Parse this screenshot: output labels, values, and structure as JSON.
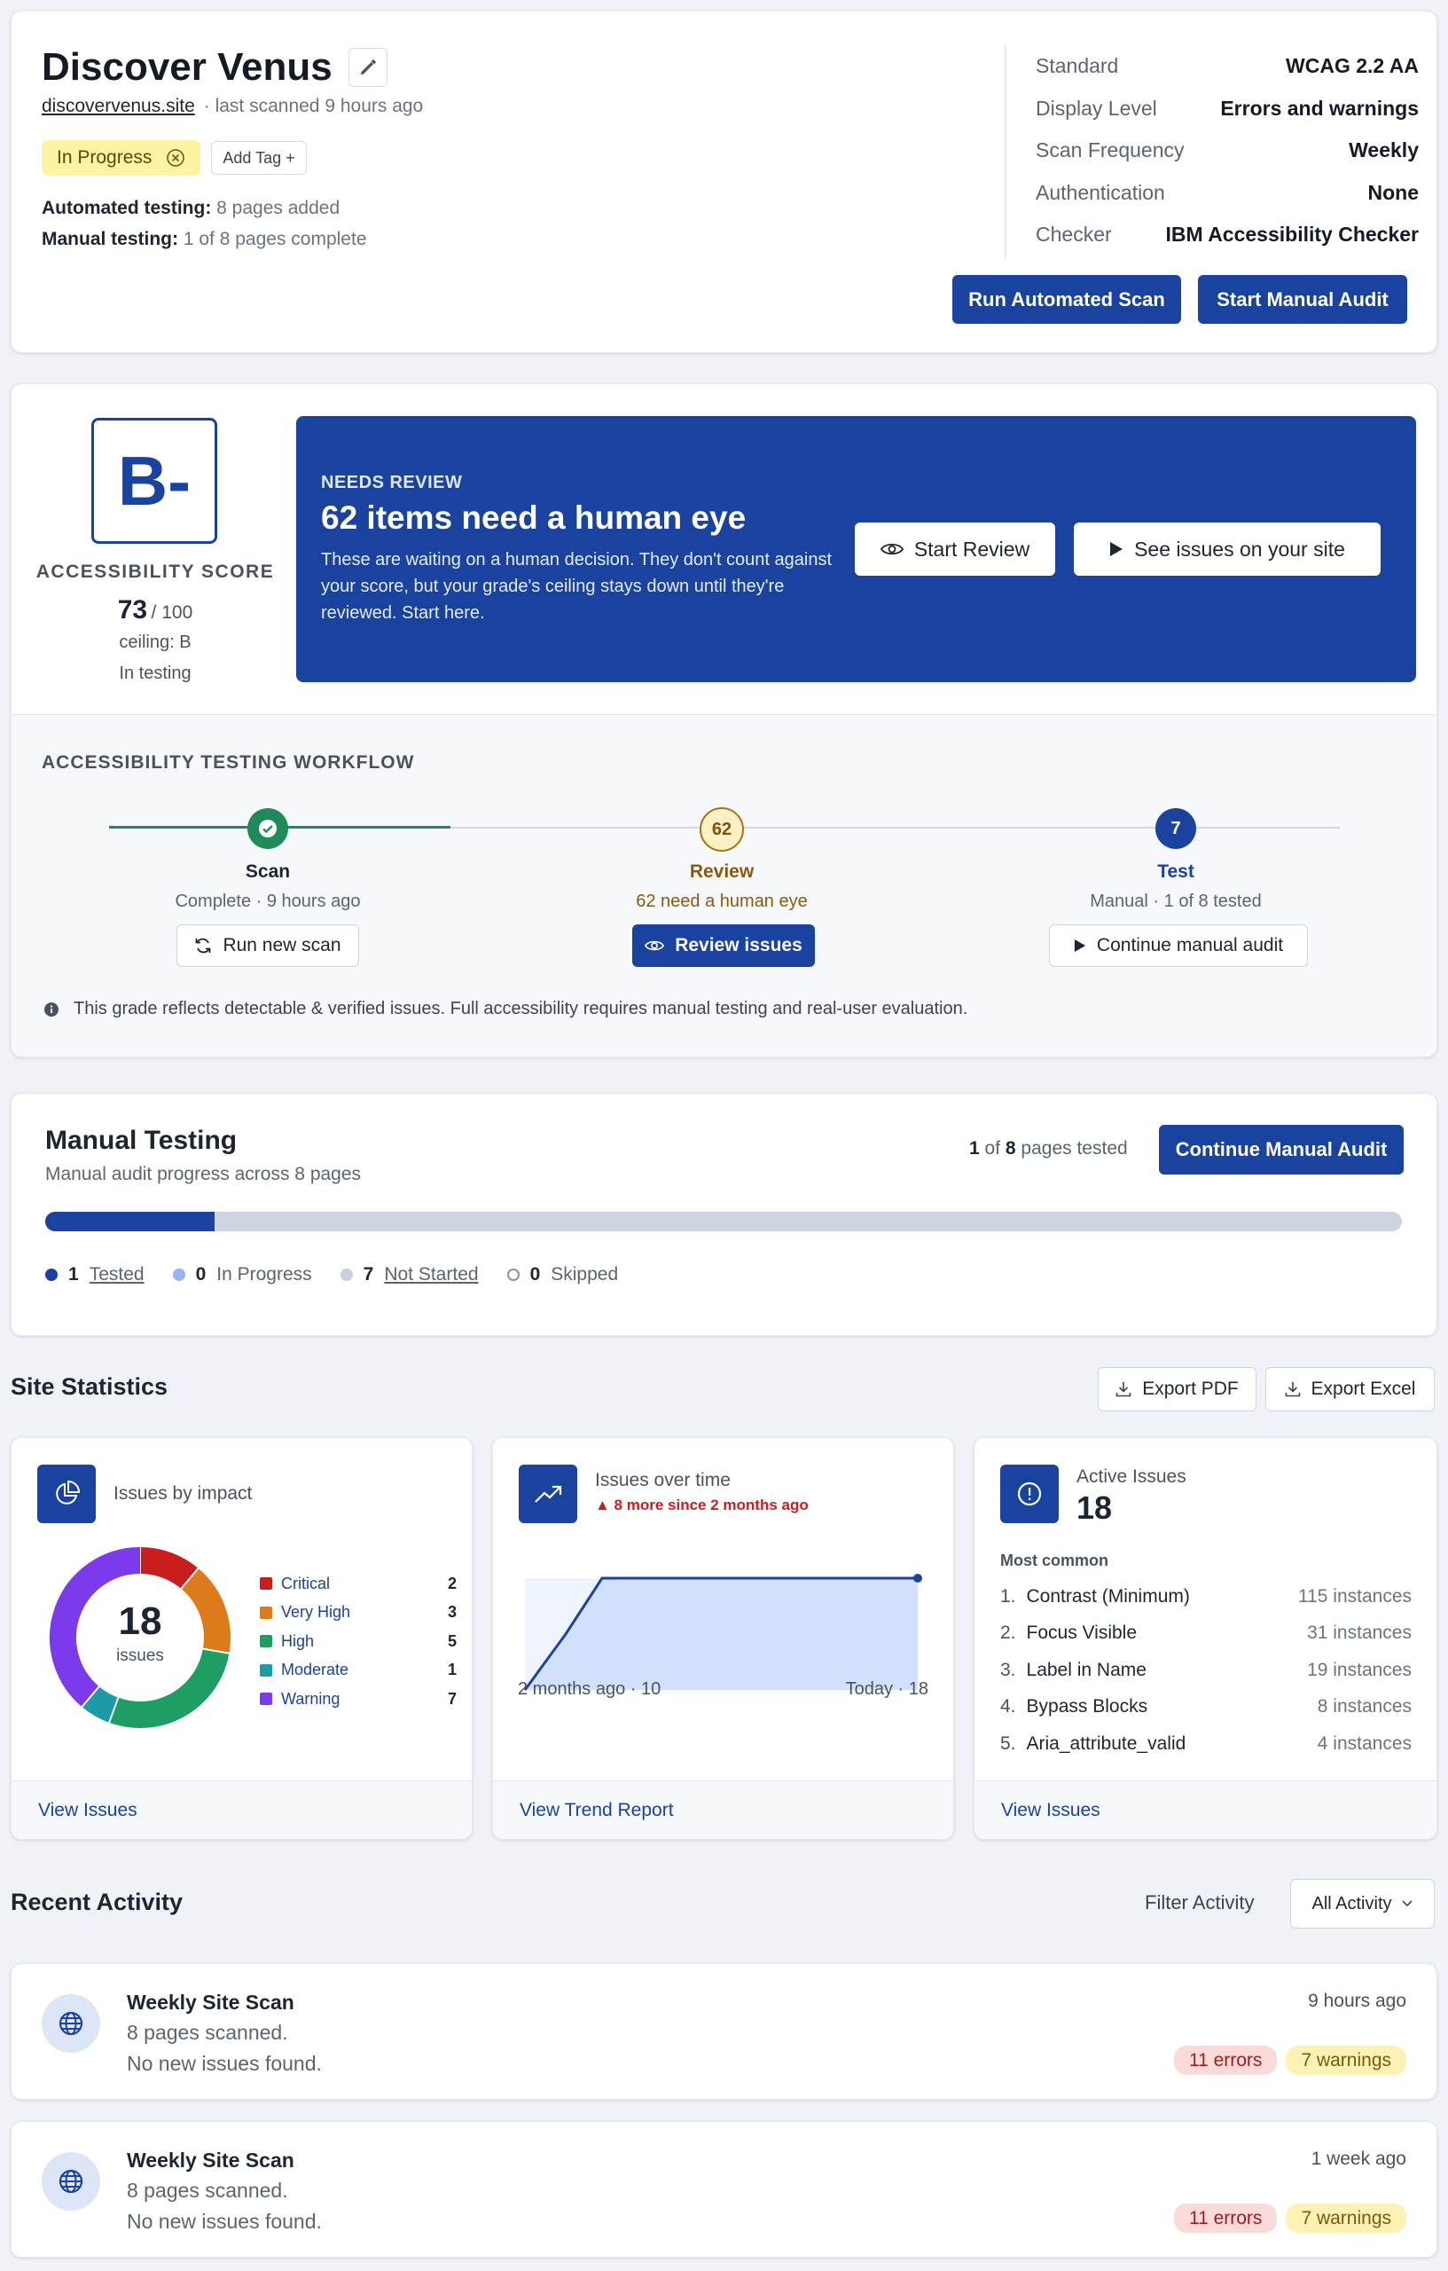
{
  "header": {
    "title": "Discover Venus",
    "site_link": "discovervenus.site",
    "scan_info": "· last scanned 9 hours ago",
    "status_tag": "In Progress",
    "add_tag": "Add Tag +",
    "automated_label": "Automated testing:",
    "automated_value": "8 pages added",
    "manual_label": "Manual testing:",
    "manual_value": "1 of 8 pages complete",
    "settings": [
      {
        "label": "Standard",
        "value": "WCAG 2.2 AA"
      },
      {
        "label": "Display Level",
        "value": "Errors and warnings"
      },
      {
        "label": "Scan Frequency",
        "value": "Weekly"
      },
      {
        "label": "Authentication",
        "value": "None"
      },
      {
        "label": "Checker",
        "value": "IBM Accessibility Checker"
      }
    ],
    "run_scan_button": "Run Automated Scan",
    "start_audit_button": "Start Manual Audit"
  },
  "score": {
    "grade": "B-",
    "label": "ACCESSIBILITY SCORE",
    "value": "73",
    "max": "/ 100",
    "ceiling": "ceiling: B",
    "state": "In testing"
  },
  "review_banner": {
    "eyebrow": "NEEDS REVIEW",
    "title": "62 items need a human eye",
    "body": "These are waiting on a human decision. They don't count against your score, but your grade's ceiling stays down until they're reviewed. Start here.",
    "start_review": "Start Review",
    "see_issues": "See issues on your site"
  },
  "workflow": {
    "title": "ACCESSIBILITY TESTING WORKFLOW",
    "steps": [
      {
        "name": "Scan",
        "detail": "Complete · 9 hours ago",
        "action": "Run new scan"
      },
      {
        "badge": "62",
        "name": "Review",
        "detail": "62 need a human eye",
        "action": "Review issues"
      },
      {
        "badge": "7",
        "name": "Test",
        "detail": "Manual · 1 of 8 tested",
        "action": "Continue manual audit"
      }
    ],
    "note": "This grade reflects detectable & verified issues. Full accessibility requires manual testing and real-user evaluation."
  },
  "manual_testing": {
    "title": "Manual Testing",
    "subtitle": "Manual audit progress across 8 pages",
    "tested_count": "1",
    "of_text": "of",
    "total_count": "8",
    "pages_tested_text": "pages tested",
    "button": "Continue Manual Audit",
    "progress_fraction": 0.125,
    "legend": [
      {
        "count": "1",
        "label": "Tested",
        "color": "#1a43a0"
      },
      {
        "count": "0",
        "label": "In Progress",
        "color": "#93b4f4"
      },
      {
        "count": "7",
        "label": "Not Started",
        "color": "#c7d0dc"
      },
      {
        "count": "0",
        "label": "Skipped",
        "color": "#ffffff"
      }
    ]
  },
  "site_statistics": {
    "title": "Site Statistics",
    "export_pdf": "Export PDF",
    "export_excel": "Export Excel"
  },
  "impact_card": {
    "title": "Issues by impact",
    "total": "18",
    "total_label": "issues",
    "link": "View Issues",
    "chart_data": {
      "type": "pie",
      "categories": [
        "Critical",
        "Very High",
        "High",
        "Moderate",
        "Warning"
      ],
      "values": [
        2,
        3,
        5,
        1,
        7
      ],
      "colors": [
        "#c81e1e",
        "#dd7a1c",
        "#1e9e62",
        "#1b9aa8",
        "#7c3aed"
      ]
    }
  },
  "trend_card": {
    "title": "Issues over time",
    "delta": "▲ 8 more since 2 months ago",
    "start_label": "2 months ago · 10",
    "end_label": "Today · 18",
    "link": "View Trend Report",
    "chart_data": {
      "type": "area",
      "x": [
        "2 months ago",
        "",
        "",
        "",
        "Today"
      ],
      "values": [
        10,
        14,
        18,
        18,
        18
      ],
      "ylim": [
        10,
        18
      ]
    }
  },
  "active_card": {
    "title": "Active Issues",
    "count": "18",
    "subtitle": "Most common",
    "items": [
      {
        "num": "1.",
        "name": "Contrast (Minimum)",
        "count": "115 instances"
      },
      {
        "num": "2.",
        "name": "Focus Visible",
        "count": "31 instances"
      },
      {
        "num": "3.",
        "name": "Label in Name",
        "count": "19 instances"
      },
      {
        "num": "4.",
        "name": "Bypass Blocks",
        "count": "8 instances"
      },
      {
        "num": "5.",
        "name": "Aria_attribute_valid",
        "count": "4 instances"
      }
    ],
    "link": "View Issues"
  },
  "recent_activity": {
    "title": "Recent Activity",
    "filter_label": "Filter Activity",
    "filter_value": "All Activity",
    "items": [
      {
        "title": "Weekly Site Scan",
        "line1": "8 pages scanned.",
        "line2": "No new issues found.",
        "time": "9 hours ago",
        "errors": "11 errors",
        "warnings": "7 warnings"
      },
      {
        "title": "Weekly Site Scan",
        "line1": "8 pages scanned.",
        "line2": "No new issues found.",
        "time": "1 week ago",
        "errors": "11 errors",
        "warnings": "7 warnings"
      }
    ]
  }
}
